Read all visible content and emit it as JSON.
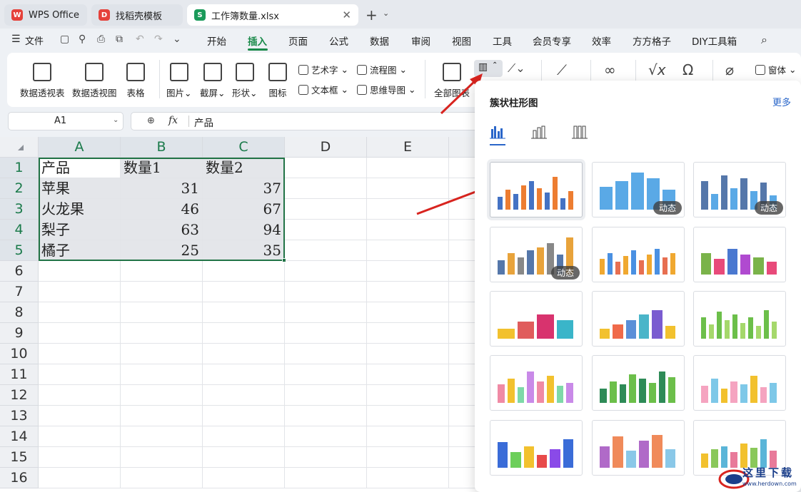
{
  "tabs": [
    {
      "label": "WPS Office",
      "logo": "W",
      "color": "#e5413a"
    },
    {
      "label": "找稻壳模板",
      "logo": "D",
      "color": "#e5413a"
    },
    {
      "label": "工作簿数量.xlsx",
      "logo": "S",
      "color": "#1a9a5a"
    }
  ],
  "menu": {
    "file": "文件",
    "items": [
      "开始",
      "插入",
      "页面",
      "公式",
      "数据",
      "审阅",
      "视图",
      "工具",
      "会员专享",
      "效率",
      "方方格子",
      "DIY工具箱"
    ],
    "active": "插入"
  },
  "ribbon": {
    "pivot_table": "数据透视表",
    "pivot_chart": "数据透视图",
    "table": "表格",
    "picture": "图片",
    "screenshot": "截屏",
    "shape": "形状",
    "icon": "图标",
    "wordart": "艺术字",
    "textbox": "文本框",
    "flowchart": "流程图",
    "mindmap": "思维导图",
    "all_charts": "全部图表",
    "form": "窗体"
  },
  "formula_bar": {
    "cell_ref": "A1",
    "fx": "fx",
    "value": "产品"
  },
  "sheet": {
    "columns": [
      "A",
      "B",
      "C",
      "D",
      "E"
    ],
    "rows": [
      "1",
      "2",
      "3",
      "4",
      "5",
      "6",
      "7",
      "8",
      "9",
      "10",
      "11",
      "12",
      "13",
      "14",
      "15",
      "16"
    ],
    "data": [
      [
        "产品",
        "数量1",
        "数量2"
      ],
      [
        "苹果",
        "31",
        "37"
      ],
      [
        "火龙果",
        "46",
        "67"
      ],
      [
        "梨子",
        "63",
        "94"
      ],
      [
        "橘子",
        "25",
        "35"
      ]
    ]
  },
  "chart_panel": {
    "title": "簇状柱形图",
    "more": "更多",
    "badge": "动态"
  },
  "watermark": {
    "text": "这里下载",
    "sub": "www.herdown.com"
  }
}
